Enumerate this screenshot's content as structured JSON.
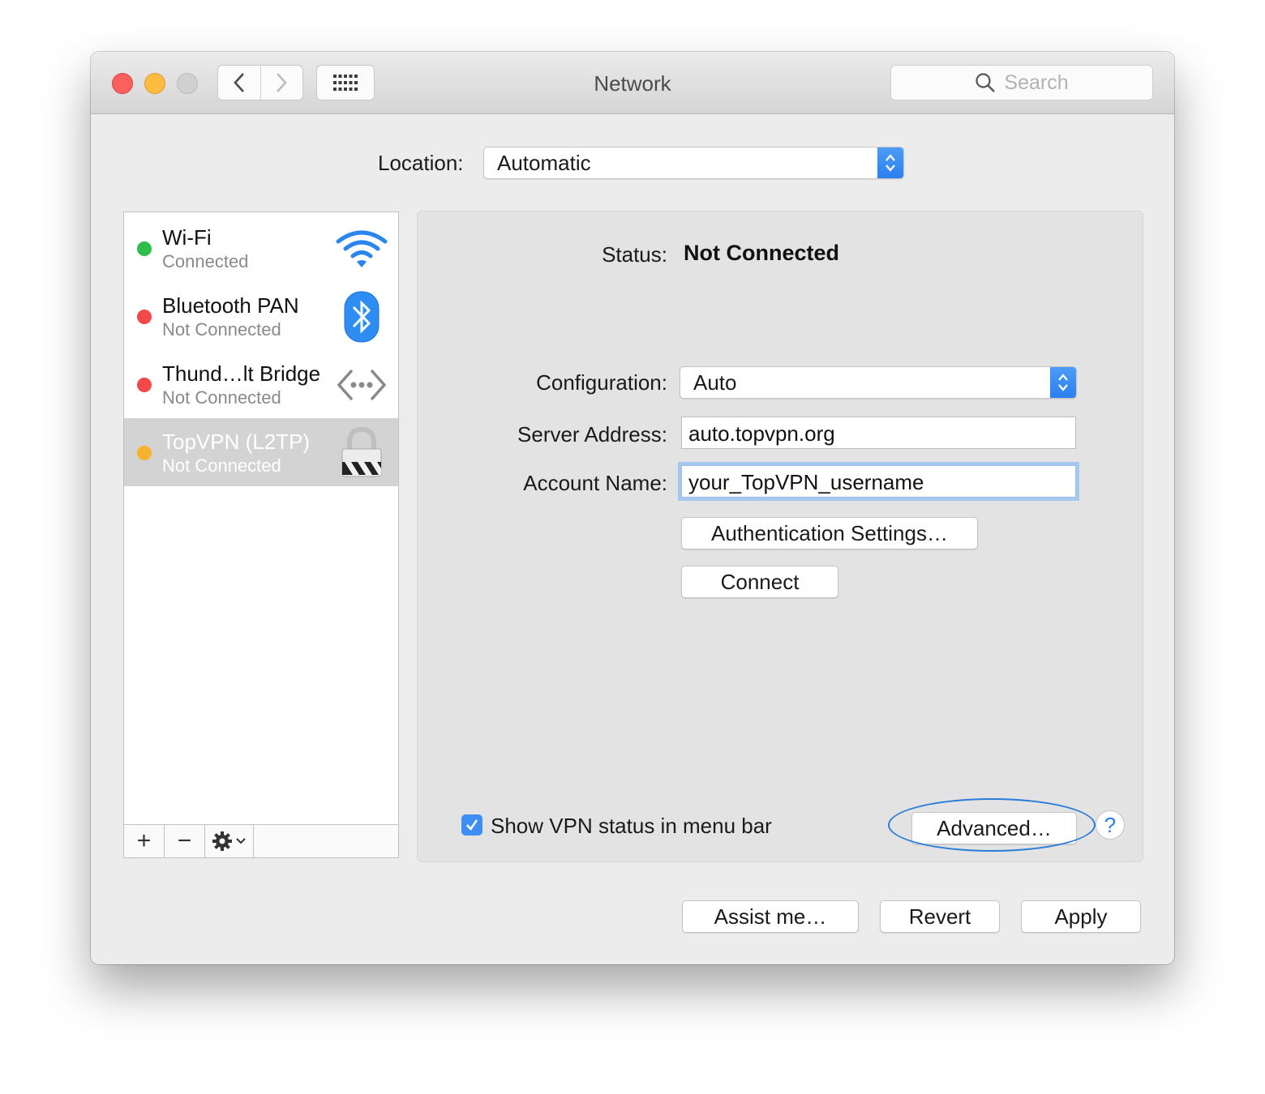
{
  "window": {
    "title": "Network"
  },
  "toolbar": {
    "search_placeholder": "Search"
  },
  "location": {
    "label": "Location:",
    "value": "Automatic"
  },
  "services": [
    {
      "name": "Wi-Fi",
      "status": "Connected",
      "dot_color": "#2ebd48",
      "icon": "wifi-icon"
    },
    {
      "name": "Bluetooth PAN",
      "status": "Not Connected",
      "dot_color": "#f4494a",
      "icon": "bluetooth-icon"
    },
    {
      "name": "Thund…lt Bridge",
      "status": "Not Connected",
      "dot_color": "#f4494a",
      "icon": "thunderbolt-bridge-icon"
    },
    {
      "name": "TopVPN (L2TP)",
      "status": "Not Connected",
      "dot_color": "#f7b32d",
      "icon": "vpn-lock-icon",
      "selected": true
    }
  ],
  "sidebar_controls": {
    "add": "+",
    "remove": "−"
  },
  "detail": {
    "status_label": "Status:",
    "status_value": "Not Connected",
    "configuration_label": "Configuration:",
    "configuration_value": "Auto",
    "server_label": "Server Address:",
    "server_value": "auto.topvpn.org",
    "account_label": "Account Name:",
    "account_value": "your_TopVPN_username",
    "auth_button": "Authentication Settings…",
    "connect_button": "Connect",
    "show_vpn_label": "Show VPN status in menu bar",
    "show_vpn_checked": true,
    "advanced_button": "Advanced…",
    "help": "?"
  },
  "footer": {
    "assist": "Assist me…",
    "revert": "Revert",
    "apply": "Apply"
  },
  "colors": {
    "accent": "#2b7ff0",
    "highlight_ring": "#2a7dd8"
  }
}
